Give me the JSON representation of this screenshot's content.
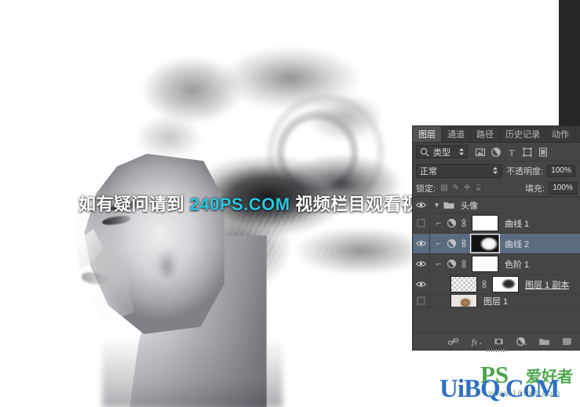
{
  "canvas": {
    "artwork_description": "black-and-white female profile portrait with smoke dispersion hair effect",
    "watermark_prefix": "如有疑问请到 ",
    "watermark_brand": "240PS.COM",
    "watermark_suffix": " 视频栏目观看视频教程"
  },
  "logos": {
    "uibq": "UiBQ.CoM",
    "ps_mark": "PS",
    "ps_cn": "爱好者",
    "ps_url": "www.16xx8.com"
  },
  "panel": {
    "tabs": [
      {
        "label": "图层",
        "active": true
      },
      {
        "label": "通道",
        "active": false
      },
      {
        "label": "路径",
        "active": false
      },
      {
        "label": "历史记录",
        "active": false
      },
      {
        "label": "动作",
        "active": false
      }
    ],
    "filter": {
      "search_icon": "search-icon",
      "type_label": "类型",
      "stepper_icon": "updown-arrows-icon",
      "icons": [
        "pixel-layer-filter-icon",
        "adjustment-layer-filter-icon",
        "type-layer-filter-icon",
        "shape-layer-filter-icon",
        "smart-object-filter-icon"
      ]
    },
    "blend": {
      "mode": "正常",
      "mode_stepper_icon": "updown-arrows-icon",
      "opacity_label": "不透明度:",
      "opacity_value": "100%"
    },
    "lock": {
      "lock_label": "锁定:",
      "lock_icons": [
        "lock-transparent-icon",
        "lock-image-icon",
        "lock-position-icon",
        "lock-all-icon"
      ],
      "fill_label": "填充:",
      "fill_value": "100%"
    },
    "layers": [
      {
        "kind": "group",
        "name": "头像",
        "visible": true,
        "expanded": true,
        "selected": false,
        "icon": "folder-icon"
      },
      {
        "kind": "adjustment",
        "name": "曲线 1",
        "visible": false,
        "selected": false,
        "clipped": true,
        "adj_icon": "curves-adjustment-icon",
        "link_icon": "mask-link-icon",
        "thumb": "white-mask"
      },
      {
        "kind": "adjustment",
        "name": "曲线 2",
        "visible": true,
        "selected": true,
        "clipped": true,
        "adj_icon": "curves-adjustment-icon",
        "link_icon": "mask-link-icon",
        "thumb": "face-mask"
      },
      {
        "kind": "adjustment",
        "name": "色阶 1",
        "visible": true,
        "selected": false,
        "clipped": true,
        "adj_icon": "levels-adjustment-icon",
        "link_icon": "mask-link-icon",
        "thumb": "white-mask"
      },
      {
        "kind": "pixel",
        "name": "图层 1 副本",
        "visible": true,
        "selected": false,
        "clipped": false,
        "link_icon": "mask-link-icon",
        "thumb": "transparent-hair",
        "mask_thumb": "hair-mask",
        "underlined": true
      },
      {
        "kind": "pixel",
        "name": "图层 1",
        "visible": false,
        "selected": false,
        "thumb": "portrait",
        "partial": true
      }
    ],
    "bottom_toolbar": [
      "link-layers-icon",
      "layer-style-fx-icon",
      "add-layer-mask-icon",
      "new-adjustment-layer-icon",
      "new-group-icon",
      "new-layer-icon"
    ]
  }
}
